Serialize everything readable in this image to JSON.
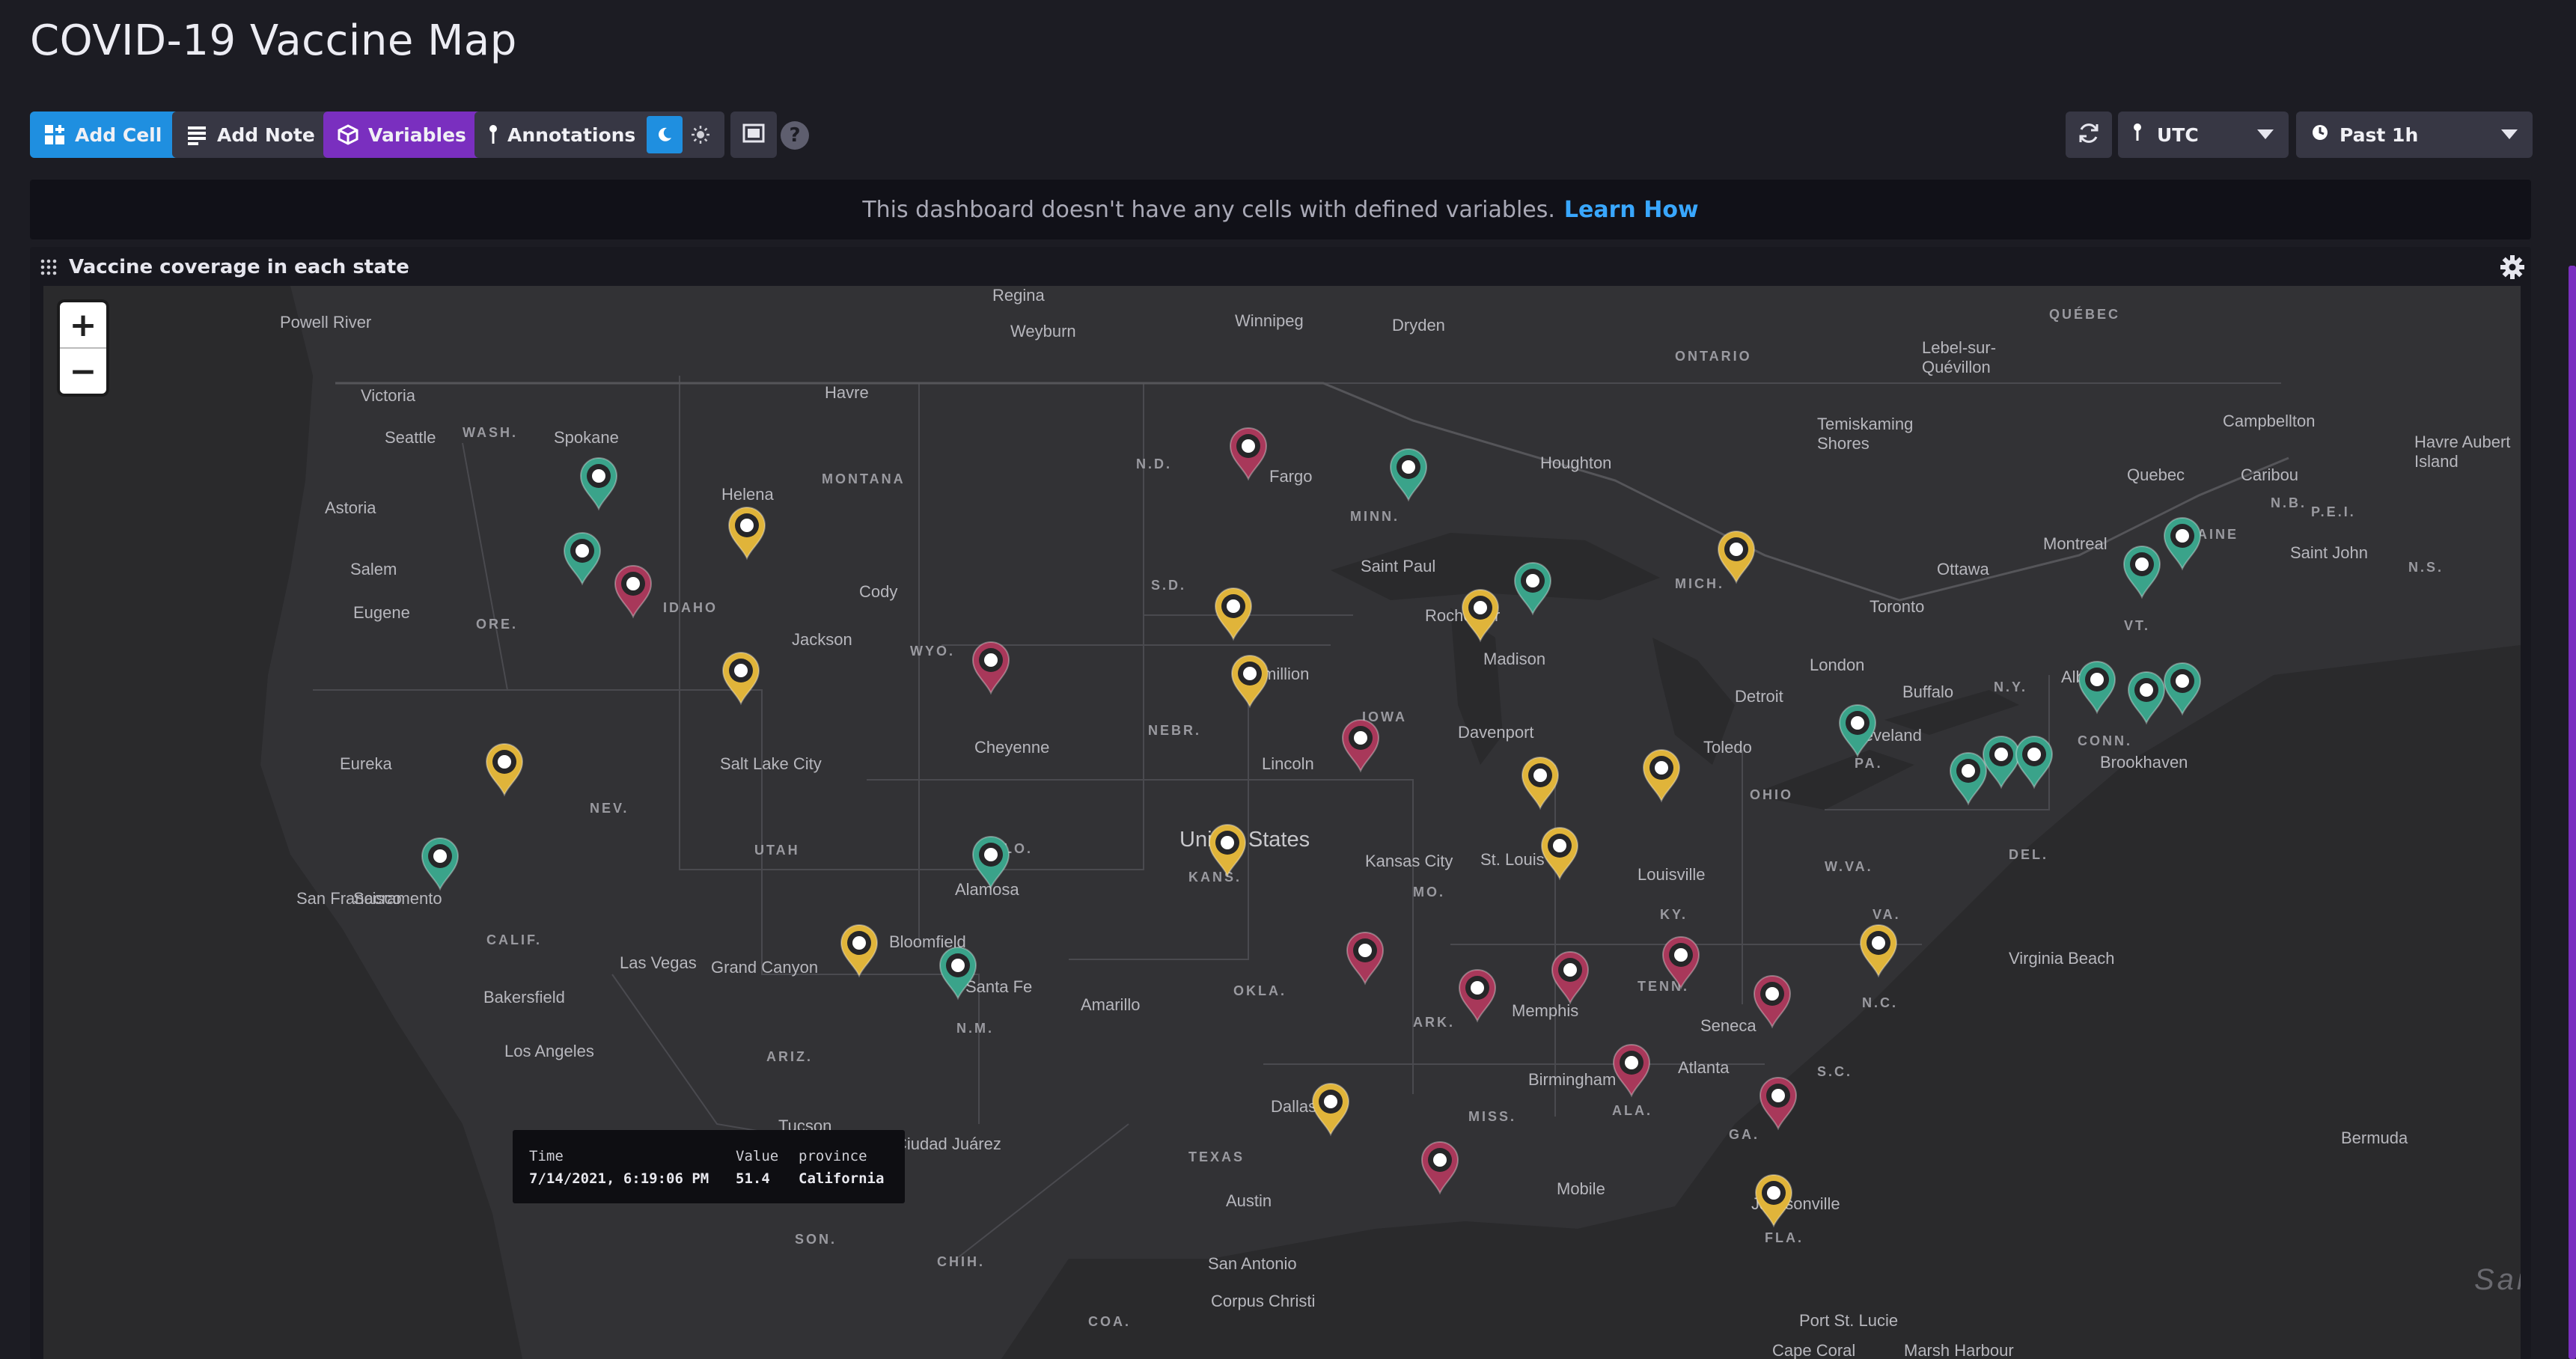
{
  "page": {
    "title": "COVID-19 Vaccine Map"
  },
  "toolbar": {
    "add_cell": "Add Cell",
    "add_note": "Add Note",
    "variables": "Variables",
    "annotations": "Annotations",
    "timezone": "UTC",
    "time_range": "Past 1h",
    "help": "?"
  },
  "banner": {
    "message": "This dashboard doesn't have any cells with defined variables.",
    "link": "Learn How"
  },
  "cell": {
    "title": "Vaccine coverage in each state"
  },
  "map": {
    "zoom_in": "+",
    "zoom_out": "−",
    "country_label": "United States",
    "pin_colors": {
      "green": "#3aa38a",
      "yellow": "#e0b43a",
      "red": "#a8385a"
    }
  },
  "tooltip": {
    "headers": [
      "Time",
      "Value",
      "province"
    ],
    "values": [
      "7/14/2021, 6:19:06 PM",
      "51.4",
      "California"
    ]
  }
}
